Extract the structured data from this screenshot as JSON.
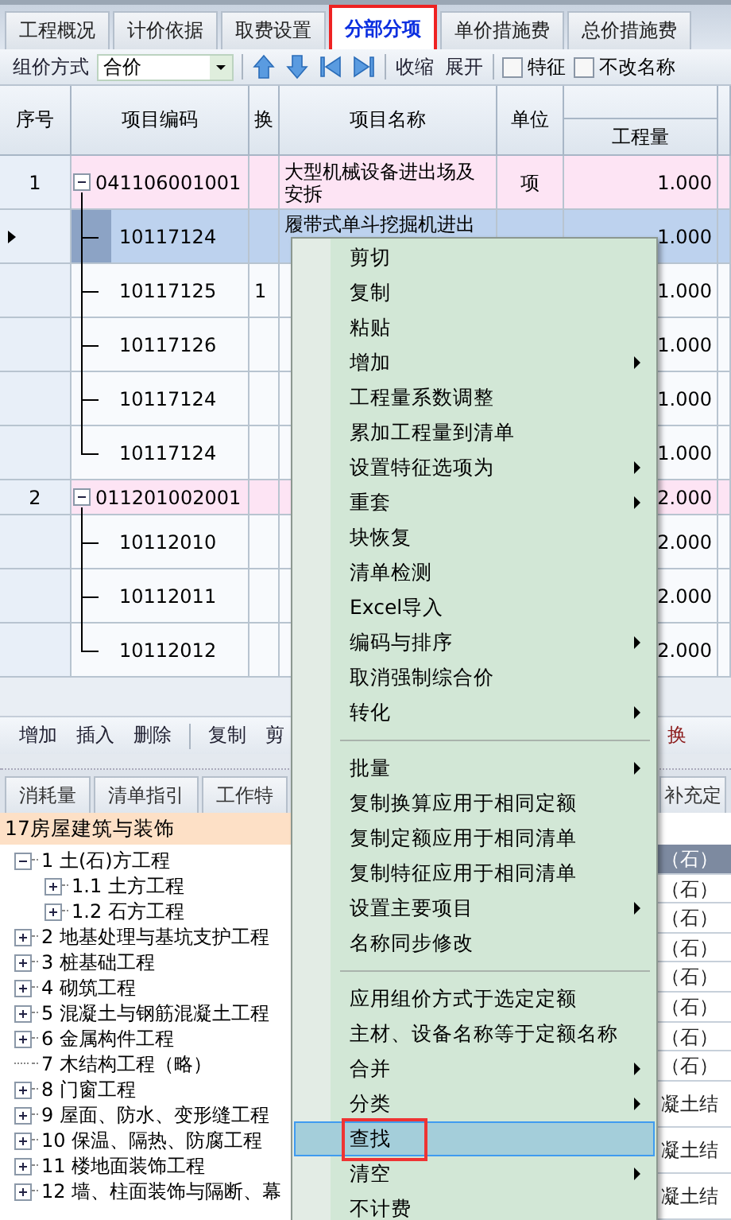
{
  "tabs": [
    {
      "label": "工程概况",
      "selected": false
    },
    {
      "label": "计价依据",
      "selected": false
    },
    {
      "label": "取费设置",
      "selected": false
    },
    {
      "label": "分部分项",
      "selected": true
    },
    {
      "label": "单价措施费",
      "selected": false
    },
    {
      "label": "总价措施费",
      "selected": false
    }
  ],
  "toolbar": {
    "pricing_label": "组价方式",
    "pricing_value": "合价",
    "collapse": "收缩",
    "expand": "展开",
    "checkboxes": [
      {
        "label": "特征",
        "checked": false
      },
      {
        "label": "不改名称",
        "checked": false
      }
    ]
  },
  "grid": {
    "columns": [
      "序号",
      "项目编码",
      "换",
      "项目名称",
      "单位",
      "工程量"
    ],
    "rows": [
      {
        "kind": "list",
        "seq": "1",
        "code": "041106001001",
        "name": "大型机械设备进出场及安拆",
        "unit": "项",
        "quantity": "1.000",
        "selected": false,
        "expanded": true
      },
      {
        "kind": "quota",
        "code": "10117124",
        "name": "履带式单斗挖掘机进出",
        "quantity": "1.000",
        "selected": true
      },
      {
        "kind": "quota",
        "code": "10117125",
        "swap": "1",
        "quantity": "1.000",
        "selected": false
      },
      {
        "kind": "quota",
        "code": "10117126",
        "quantity": "1.000",
        "selected": false
      },
      {
        "kind": "quota",
        "code": "10117124",
        "quantity": "1.000",
        "selected": false
      },
      {
        "kind": "quota",
        "code": "10117124",
        "quantity": "1.000",
        "selected": false
      },
      {
        "kind": "list",
        "seq": "2",
        "code": "011201002001",
        "quantity": "2.000",
        "selected": false,
        "expanded": true
      },
      {
        "kind": "quota",
        "code": "10112010",
        "quantity": "2.000",
        "selected": false
      },
      {
        "kind": "quota",
        "code": "10112011",
        "quantity": "2.000",
        "selected": false
      },
      {
        "kind": "quota",
        "code": "10112012",
        "quantity": "2.000",
        "selected": false
      }
    ]
  },
  "bottom_toolbar": {
    "groups": [
      [
        "增加",
        "插入",
        "删除"
      ],
      [
        "复制",
        "剪"
      ]
    ],
    "right": "换"
  },
  "lower_tabs": [
    {
      "label": "消耗量",
      "selected": false
    },
    {
      "label": "清单指引",
      "selected": false
    },
    {
      "label": "工作特",
      "selected": false
    }
  ],
  "lower_tab_right": "补充定",
  "tree": {
    "title": "17房屋建筑与装饰",
    "nodes": [
      {
        "label": "1 土(石)方工程",
        "expandable": true,
        "expanded": true,
        "children": [
          {
            "label": "1.1 土方工程",
            "expandable": true,
            "expanded": false
          },
          {
            "label": "1.2 石方工程",
            "expandable": true,
            "expanded": false
          }
        ]
      },
      {
        "label": "2 地基处理与基坑支护工程",
        "expandable": true,
        "expanded": false
      },
      {
        "label": "3 桩基础工程",
        "expandable": true,
        "expanded": false
      },
      {
        "label": "4 砌筑工程",
        "expandable": true,
        "expanded": false
      },
      {
        "label": "5 混凝土与钢筋混凝土工程",
        "expandable": true,
        "expanded": false
      },
      {
        "label": "6 金属构件工程",
        "expandable": true,
        "expanded": false
      },
      {
        "label": "7 木结构工程（略）",
        "expandable": false
      },
      {
        "label": "8 门窗工程",
        "expandable": true,
        "expanded": false
      },
      {
        "label": "9 屋面、防水、变形缝工程",
        "expandable": true,
        "expanded": false
      },
      {
        "label": "10 保温、隔热、防腐工程",
        "expandable": true,
        "expanded": false
      },
      {
        "label": "11 楼地面装饰工程",
        "expandable": true,
        "expanded": false
      },
      {
        "label": "12 墙、柱面装饰与隔断、幕",
        "expandable": true,
        "expanded": false
      }
    ]
  },
  "right_list": [
    {
      "kind": "short",
      "text": "（石）",
      "selected": true
    },
    {
      "kind": "short",
      "text": "（石）",
      "selected": false
    },
    {
      "kind": "short",
      "text": "（石）",
      "selected": false
    },
    {
      "kind": "short",
      "text": "（石）",
      "selected": false
    },
    {
      "kind": "short",
      "text": "（石）",
      "selected": false
    },
    {
      "kind": "short",
      "text": "（石）",
      "selected": false
    },
    {
      "kind": "short",
      "text": "（石）",
      "selected": false
    },
    {
      "kind": "short",
      "text": "（石）",
      "selected": false
    },
    {
      "kind": "tall",
      "text": "凝土结",
      "selected": false
    },
    {
      "kind": "tall",
      "text": "凝土结",
      "selected": false
    },
    {
      "kind": "tall",
      "text": "凝土结",
      "selected": false
    }
  ],
  "context_menu": [
    {
      "kind": "item",
      "label": "剪切",
      "submenu": false,
      "selected": false
    },
    {
      "kind": "item",
      "label": "复制",
      "submenu": false,
      "selected": false
    },
    {
      "kind": "item",
      "label": "粘贴",
      "submenu": false,
      "selected": false
    },
    {
      "kind": "item",
      "label": "增加",
      "submenu": true,
      "selected": false
    },
    {
      "kind": "item",
      "label": "工程量系数调整",
      "submenu": false,
      "selected": false
    },
    {
      "kind": "item",
      "label": "累加工程量到清单",
      "submenu": false,
      "selected": false
    },
    {
      "kind": "item",
      "label": "设置特征选项为",
      "submenu": true,
      "selected": false
    },
    {
      "kind": "item",
      "label": "重套",
      "submenu": true,
      "selected": false
    },
    {
      "kind": "item",
      "label": "块恢复",
      "submenu": false,
      "selected": false
    },
    {
      "kind": "item",
      "label": "清单检测",
      "submenu": false,
      "selected": false
    },
    {
      "kind": "item",
      "label": "Excel导入",
      "submenu": false,
      "selected": false
    },
    {
      "kind": "item",
      "label": "编码与排序",
      "submenu": true,
      "selected": false
    },
    {
      "kind": "item",
      "label": "取消强制综合价",
      "submenu": false,
      "selected": false
    },
    {
      "kind": "item",
      "label": "转化",
      "submenu": true,
      "selected": false
    },
    {
      "kind": "separator"
    },
    {
      "kind": "item",
      "label": "批量",
      "submenu": true,
      "selected": false
    },
    {
      "kind": "item",
      "label": "复制换算应用于相同定额",
      "submenu": false,
      "selected": false
    },
    {
      "kind": "item",
      "label": "复制定额应用于相同清单",
      "submenu": false,
      "selected": false
    },
    {
      "kind": "item",
      "label": "复制特征应用于相同清单",
      "submenu": false,
      "selected": false
    },
    {
      "kind": "item",
      "label": "设置主要项目",
      "submenu": true,
      "selected": false
    },
    {
      "kind": "item",
      "label": "名称同步修改",
      "submenu": false,
      "selected": false
    },
    {
      "kind": "separator"
    },
    {
      "kind": "item",
      "label": "应用组价方式于选定定额",
      "submenu": false,
      "selected": false
    },
    {
      "kind": "item",
      "label": "主材、设备名称等于定额名称",
      "submenu": false,
      "selected": false
    },
    {
      "kind": "item",
      "label": "合并",
      "submenu": true,
      "selected": false
    },
    {
      "kind": "item",
      "label": "分类",
      "submenu": true,
      "selected": false
    },
    {
      "kind": "item",
      "label": "查找",
      "submenu": false,
      "selected": true
    },
    {
      "kind": "item",
      "label": "清空",
      "submenu": true,
      "selected": false
    },
    {
      "kind": "item",
      "label": "不计费",
      "submenu": false,
      "selected": false
    }
  ]
}
